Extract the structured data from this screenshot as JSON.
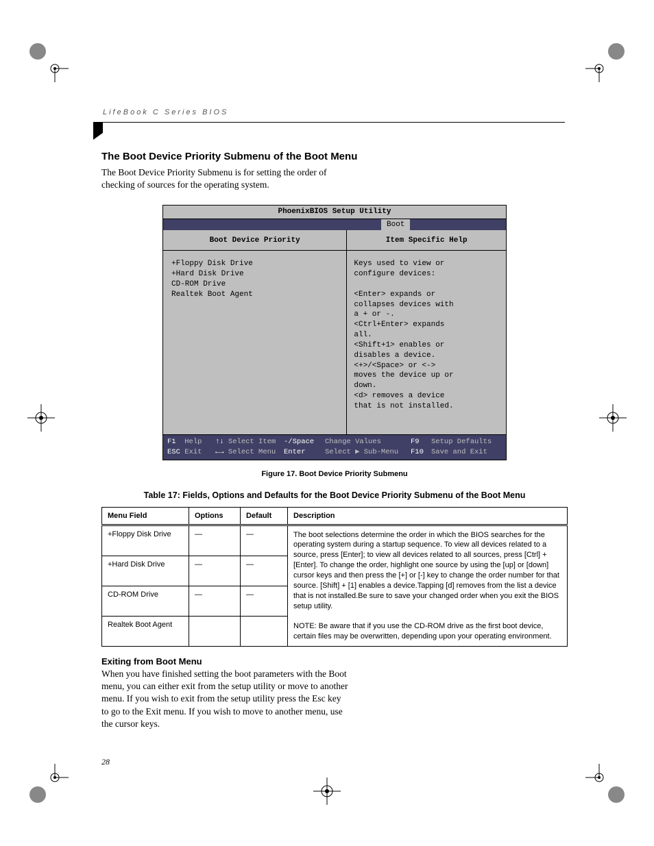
{
  "header": {
    "running": "LifeBook C Series BIOS"
  },
  "section": {
    "title": "The Boot Device Priority Submenu of the Boot Menu",
    "intro": "The Boot Device Priority Submenu is for setting the order of checking of sources for the operating system."
  },
  "bios": {
    "window_title": "PhoenixBIOS Setup Utility",
    "active_tab": "Boot",
    "left_title": "Boot Device Priority",
    "right_title": "Item Specific Help",
    "items": [
      "+Floppy Disk Drive",
      "+Hard Disk Drive",
      " CD-ROM Drive",
      " Realtek Boot Agent"
    ],
    "help_lines": [
      "Keys used to view or",
      "configure devices:",
      "",
      "<Enter> expands or",
      "collapses devices with",
      "a + or -.",
      "<Ctrl+Enter> expands",
      "all.",
      "<Shift+1> enables or",
      "disables a device.",
      "<+>/<Space> or <->",
      "moves the device up or",
      "down.",
      "<d> removes a device",
      "that is not installed."
    ],
    "footer": {
      "r1": {
        "k1": "F1",
        "v1": "Help",
        "k2": "↑↓",
        "v2": "Select Item",
        "k3": "-/Space",
        "v3": "Change Values",
        "k4": "F9",
        "v4": "Setup Defaults"
      },
      "r2": {
        "k1": "ESC",
        "v1": "Exit",
        "k2": "←→",
        "v2": "Select Menu",
        "k3": "Enter",
        "v3": "Select ▶ Sub-Menu",
        "k4": "F10",
        "v4": "Save and Exit"
      }
    }
  },
  "figure_caption": "Figure 17.  Boot Device Priority Submenu",
  "table": {
    "title": "Table 17: Fields, Options and Defaults for the Boot Device Priority Submenu of the Boot Menu",
    "headers": [
      "Menu Field",
      "Options",
      "Default",
      "Description"
    ],
    "rows": [
      {
        "menu": "+Floppy Disk Drive",
        "opt": "—",
        "def": "—"
      },
      {
        "menu": "+Hard Disk Drive",
        "opt": "—",
        "def": "—"
      },
      {
        "menu": "CD-ROM Drive",
        "opt": "—",
        "def": "—"
      },
      {
        "menu": "Realtek Boot Agent",
        "opt": "",
        "def": ""
      }
    ],
    "description_main": "The boot selections determine the order in which the BIOS searches for the operating system during a startup sequence. To view all devices related to a source, press [Enter]; to view all devices related to all sources, press [Ctrl] + [Enter]. To change the order, highlight one source by using the [up] or [down] cursor keys and then press the [+] or [-] key to change the order number for that source. [Shift] + [1] enables a device.Tapping [d] removes from the list a device that is not installed.Be sure to save your changed order when you exit the BIOS setup utility.",
    "description_note": "NOTE: Be aware that if you use the CD-ROM drive as the first boot device, certain files may be overwritten, depending upon your operating environment."
  },
  "exit": {
    "title": "Exiting from Boot Menu",
    "body": "When you have finished setting the boot parameters with the Boot menu, you can either exit from the setup utility or move to another menu. If you wish to exit from the setup utility press the Esc key to go to the Exit menu. If you wish to move to another menu, use the cursor keys."
  },
  "page_number": "28"
}
